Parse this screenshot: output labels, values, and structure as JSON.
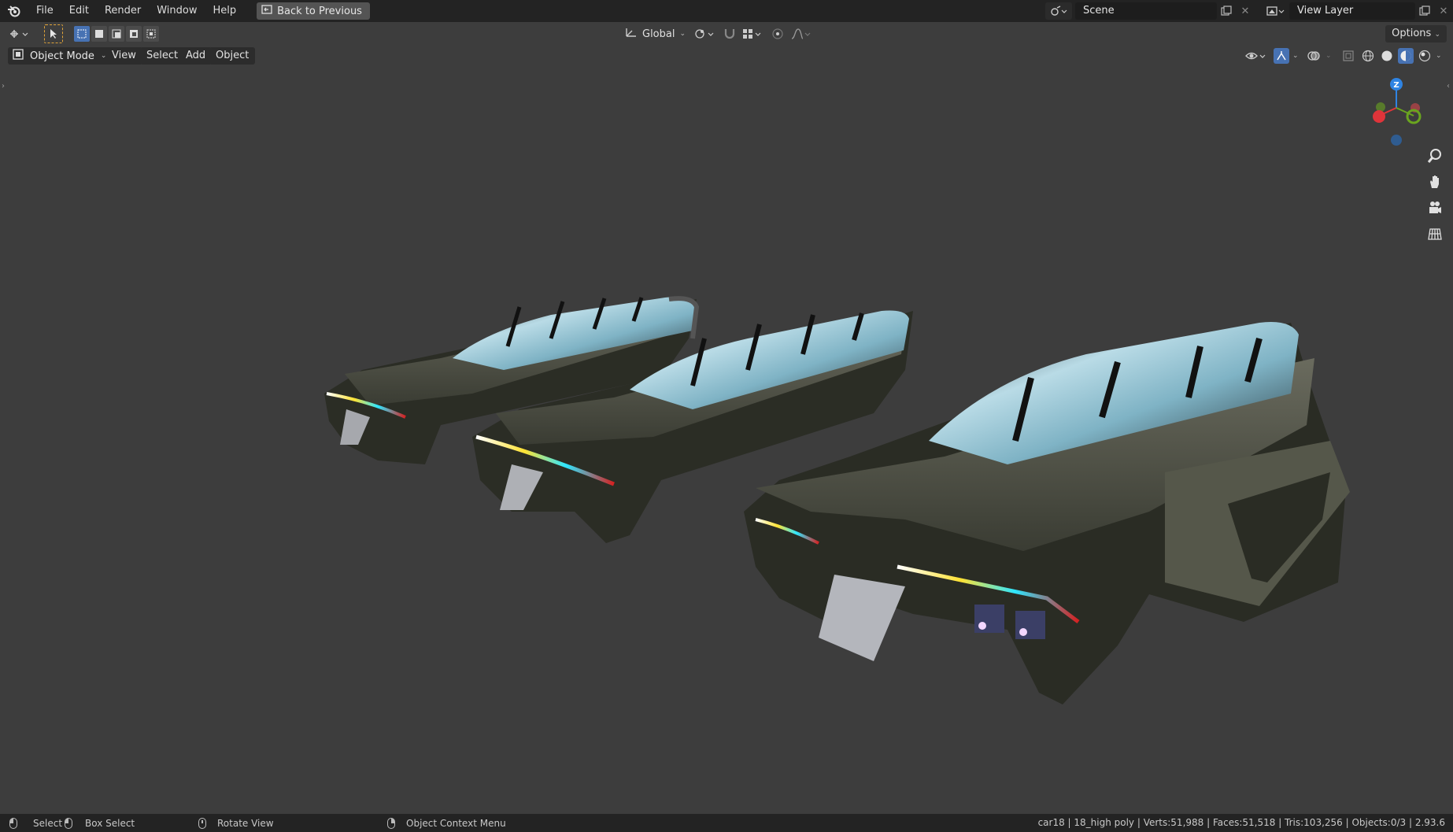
{
  "menu": {
    "items": [
      "File",
      "Edit",
      "Render",
      "Window",
      "Help"
    ],
    "back_button": "Back to Previous"
  },
  "topbar": {
    "scene": "Scene",
    "view_layer": "View Layer"
  },
  "toolheader": {
    "orientation": "Global",
    "options": "Options"
  },
  "viewport_header": {
    "mode": "Object Mode",
    "menus": [
      "View",
      "Select",
      "Add",
      "Object"
    ]
  },
  "gizmo": {
    "z_label": "Z"
  },
  "statusbar": {
    "select": "Select",
    "box_select": "Box Select",
    "rotate_view": "Rotate View",
    "context_menu": "Object Context Menu",
    "stats": "car18 | 18_high poly | Verts:51,988 | Faces:51,518 | Tris:103,256 | Objects:0/3 | 2.93.6"
  },
  "colors": {
    "accent": "#4772b3",
    "axis_x": "#e0343a",
    "axis_y": "#6aa51f",
    "axis_z": "#2f84e3",
    "active_tool": "#e0a43a"
  }
}
